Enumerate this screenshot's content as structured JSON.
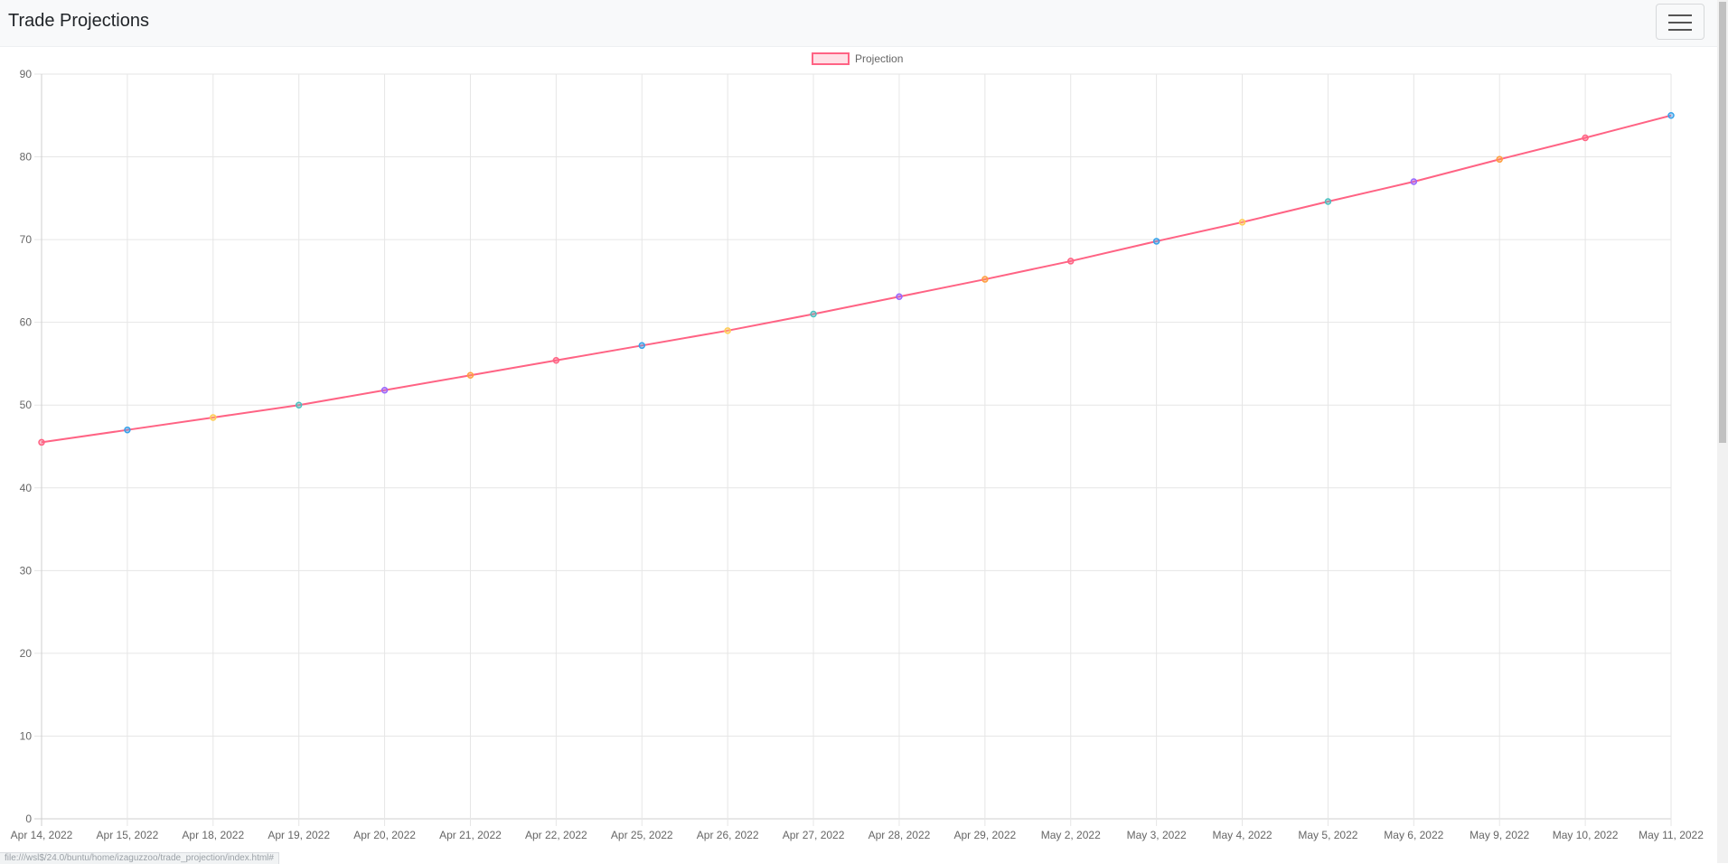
{
  "navbar": {
    "brand": "Trade Projections"
  },
  "status_bar": {
    "text": "file:///wsl$/24.0/buntu/home/izaguzzoo/trade_projection/index.html#"
  },
  "chart_data": {
    "type": "line",
    "title": "",
    "xlabel": "",
    "ylabel": "",
    "ylim": [
      0,
      90
    ],
    "yticks": [
      0,
      10,
      20,
      30,
      40,
      50,
      60,
      70,
      80,
      90
    ],
    "grid": true,
    "legend_position": "top",
    "categories": [
      "Apr 14, 2022",
      "Apr 15, 2022",
      "Apr 18, 2022",
      "Apr 19, 2022",
      "Apr 20, 2022",
      "Apr 21, 2022",
      "Apr 22, 2022",
      "Apr 25, 2022",
      "Apr 26, 2022",
      "Apr 27, 2022",
      "Apr 28, 2022",
      "Apr 29, 2022",
      "May 2, 2022",
      "May 3, 2022",
      "May 4, 2022",
      "May 5, 2022",
      "May 6, 2022",
      "May 9, 2022",
      "May 10, 2022",
      "May 11, 2022"
    ],
    "series": [
      {
        "name": "Projection",
        "line_color": "#ff6384",
        "fill_color": "#ffe0e6",
        "values": [
          45.5,
          47.0,
          48.5,
          50.0,
          51.8,
          53.6,
          55.4,
          57.2,
          59.0,
          61.0,
          63.1,
          65.2,
          67.4,
          69.8,
          72.1,
          74.6,
          77.0,
          79.7,
          82.3,
          85.0
        ],
        "point_colors": [
          "#ff6384",
          "#36a2eb",
          "#ffce56",
          "#4bc0c0",
          "#9966ff",
          "#ff9f40",
          "#ff6384",
          "#36a2eb",
          "#ffce56",
          "#4bc0c0",
          "#9966ff",
          "#ff9f40",
          "#ff6384",
          "#36a2eb",
          "#ffce56",
          "#4bc0c0",
          "#9966ff",
          "#ff9f40",
          "#ff6384",
          "#36a2eb"
        ]
      }
    ]
  }
}
